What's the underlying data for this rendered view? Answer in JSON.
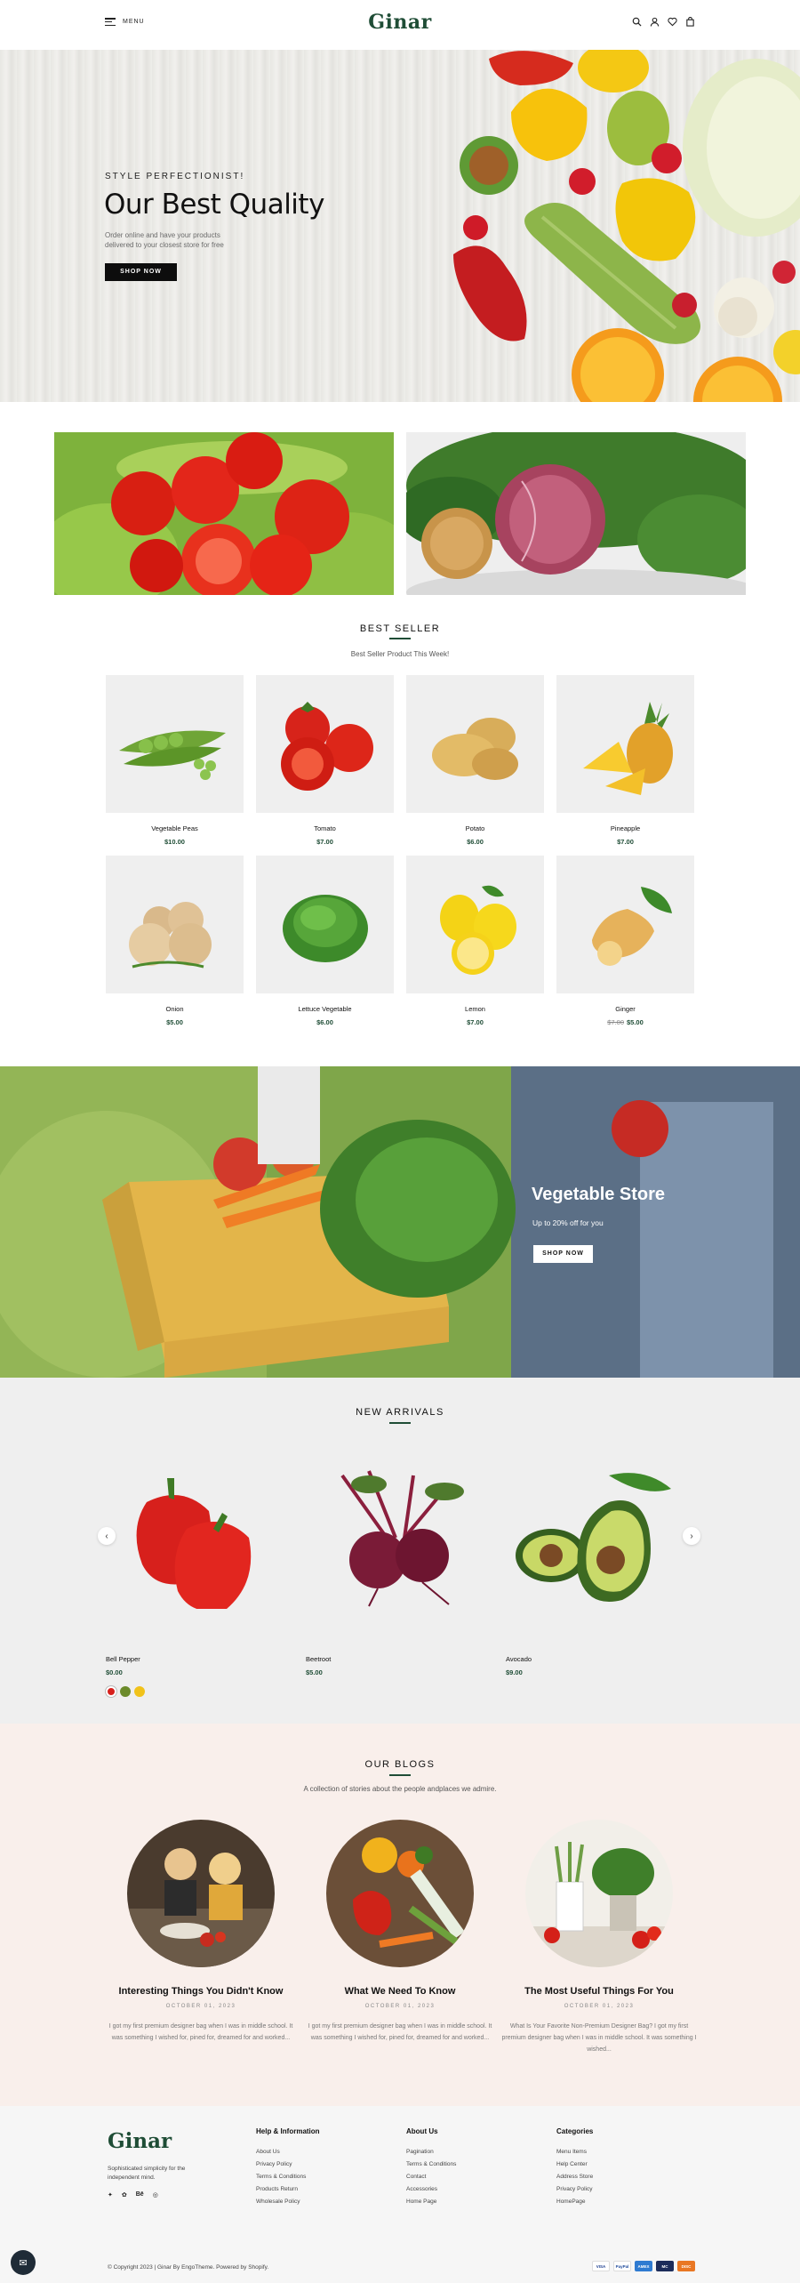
{
  "header": {
    "menu_label": "MENU",
    "logo": "Ginar",
    "icons": [
      "search-icon",
      "user-icon",
      "heart-icon",
      "bag-icon"
    ]
  },
  "hero": {
    "eyebrow": "STYLE PERFECTIONIST!",
    "title": "Our Best Quality",
    "description": "Order online and have your products delivered to your closest store for free",
    "button": "SHOP NOW"
  },
  "best_seller": {
    "title": "BEST SELLER",
    "subtitle": "Best Seller Product This Week!",
    "products": [
      {
        "name": "Vegetable Peas",
        "price": "$10.00"
      },
      {
        "name": "Tomato",
        "price": "$7.00"
      },
      {
        "name": "Potato",
        "price": "$6.00"
      },
      {
        "name": "Pineapple",
        "price": "$7.00"
      },
      {
        "name": "Onion",
        "price": "$5.00"
      },
      {
        "name": "Lettuce Vegetable",
        "price": "$6.00"
      },
      {
        "name": "Lemon",
        "price": "$7.00"
      },
      {
        "name": "Ginger",
        "old_price": "$7.00",
        "price": "$5.00"
      }
    ]
  },
  "banner": {
    "title": "Vegetable Store",
    "subtitle": "Up to 20% off for you",
    "button": "SHOP NOW"
  },
  "new_arrivals": {
    "title": "NEW ARRIVALS",
    "products": [
      {
        "name": "Bell Pepper",
        "price": "$0.00"
      },
      {
        "name": "Beetroot",
        "price": "$5.00"
      },
      {
        "name": "Avocado",
        "price": "$9.00"
      }
    ]
  },
  "blogs": {
    "title": "OUR BLOGS",
    "subtitle": "A collection of stories about the people andplaces we admire.",
    "posts": [
      {
        "title": "Interesting Things You Didn't Know",
        "date": "OCTOBER 01, 2023",
        "excerpt": "I got my first premium designer bag when I was in middle school. It was something I wished for, pined for, dreamed for and worked..."
      },
      {
        "title": "What We Need To Know",
        "date": "OCTOBER 01, 2023",
        "excerpt": "I got my first premium designer bag when I was in middle school. It was something I wished for, pined for, dreamed for and worked..."
      },
      {
        "title": "The Most Useful Things For You",
        "date": "OCTOBER 01, 2023",
        "excerpt": "What Is Your Favorite Non-Premium Designer Bag? I got my first premium designer bag when I was in middle school. It was something I wished..."
      }
    ]
  },
  "footer": {
    "logo": "Ginar",
    "tagline": "Sophisticated simplicity for the independent mind.",
    "social": [
      "Twitter",
      "Pinterest",
      "Behance",
      "Instagram"
    ],
    "columns": [
      {
        "title": "Help & Information",
        "links": [
          "About Us",
          "Privacy Policy",
          "Terms & Conditions",
          "Products Return",
          "Wholesale Policy"
        ]
      },
      {
        "title": "About Us",
        "links": [
          "Pagination",
          "Terms & Conditions",
          "Contact",
          "Accessories",
          "Home Page"
        ]
      },
      {
        "title": "Categories",
        "links": [
          "Menu Items",
          "Help Center",
          "Address Store",
          "Privacy Policy",
          "HomePage"
        ]
      }
    ],
    "copyright": "© Copyright 2023 | Ginar By EngoTheme. Powered by Shopify.",
    "payments": [
      "VISA",
      "PayPal",
      "AMEX",
      "MC",
      "DISC"
    ]
  },
  "colors": {
    "brand_green": "#1f4d36",
    "blog_bg": "#f9efeb",
    "arrivals_bg": "#efefef"
  }
}
